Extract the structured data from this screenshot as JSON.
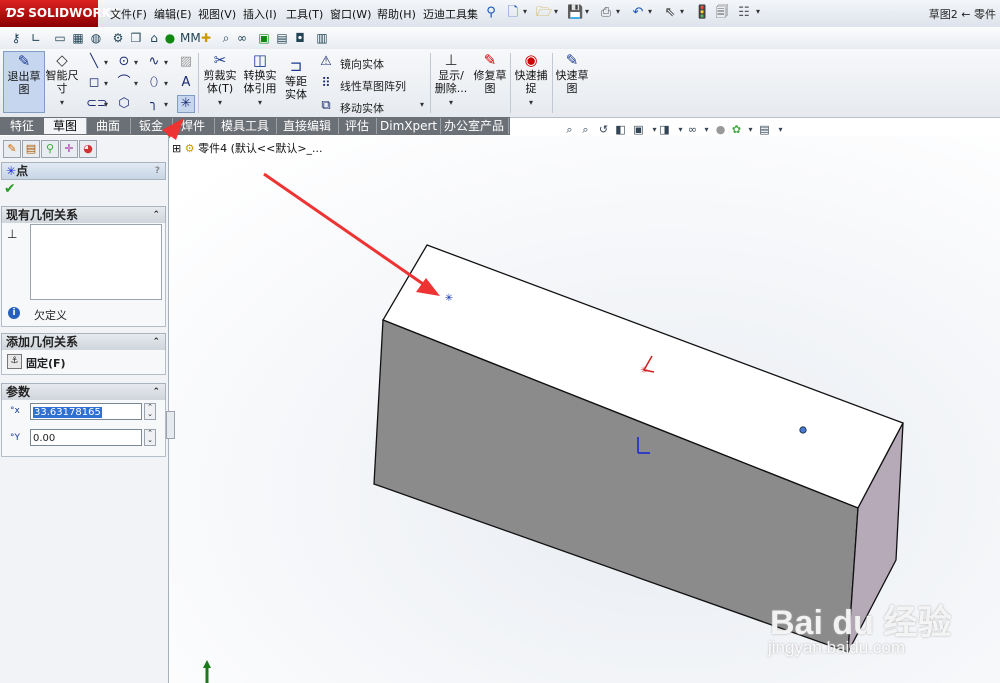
{
  "app": {
    "brand": "SOLIDWORKS",
    "window_title": "草图2 ← 零件"
  },
  "menu": [
    "文件(F)",
    "编辑(E)",
    "视图(V)",
    "插入(I)",
    "工具(T)",
    "窗口(W)",
    "帮助(H)",
    "迈迪工具集"
  ],
  "command_manager": {
    "exit_sketch": "退出草图",
    "smart_dimension": "智能尺寸",
    "trim": "剪裁实体(T)",
    "convert": "转换实体引用",
    "offset": "等距实体",
    "mirror": "镜向实体",
    "linear_pattern": "线性草图阵列",
    "move": "移动实体",
    "display_delete": "显示/删除...",
    "repair": "修复草图",
    "quick_snap": "快速捕捉",
    "rapid_sketch": "快速草图"
  },
  "tabs": [
    "特征",
    "草图",
    "曲面",
    "钣金",
    "焊件",
    "模具工具",
    "直接编辑",
    "评估",
    "DimXpert",
    "办公室产品"
  ],
  "active_tab": "草图",
  "tree": {
    "label": "零件4 (默认<<默认>_..."
  },
  "property_manager": {
    "title": "点",
    "help": "?",
    "ok": "✔",
    "existing_relations": {
      "header": "现有几何关系",
      "status": "欠定义"
    },
    "add_relations": {
      "header": "添加几何关系",
      "item": "固定(F)"
    },
    "parameters": {
      "header": "参数",
      "x_label": "x",
      "x_value": "33.63178165",
      "y_label": "Y",
      "y_value": "0.00"
    }
  },
  "watermark": {
    "logo": "Bai du 经验",
    "url": "jingyan.baidu.com"
  },
  "colors": {
    "accent": "#c00000",
    "box_top": "#ffffff",
    "box_front": "#8a8a8a",
    "box_side": "#b7a8b8",
    "arrow": "#ee3333"
  }
}
